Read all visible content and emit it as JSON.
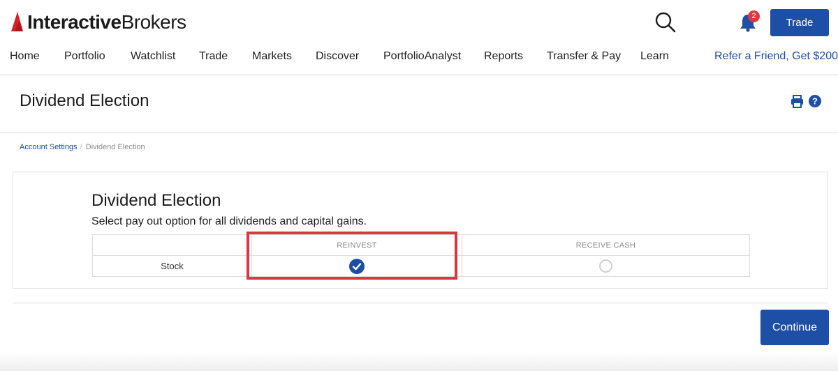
{
  "brand": {
    "name_bold": "Interactive",
    "name_regular": "Brokers",
    "accent": "#d81f26"
  },
  "colors": {
    "primary": "#1d4fa6",
    "alert": "#e2343f"
  },
  "header": {
    "notification_count": "2",
    "trade_label": "Trade",
    "icons": [
      "search-icon",
      "bell-icon"
    ]
  },
  "nav": {
    "items": [
      "Home",
      "Portfolio",
      "Watchlist",
      "Trade",
      "Markets",
      "Discover",
      "PortfolioAnalyst",
      "Reports",
      "Transfer & Pay",
      "Learn"
    ],
    "refer": "Refer a Friend, Get $200"
  },
  "page": {
    "title": "Dividend Election",
    "icons": [
      "print-icon",
      "help-icon"
    ]
  },
  "breadcrumb": {
    "parent": "Account Settings",
    "separator": "/",
    "current": "Dividend Election"
  },
  "election": {
    "title": "Dividend Election",
    "subtitle": "Select pay out option for all dividends and capital gains.",
    "columns": [
      "",
      "REINVEST",
      "RECEIVE CASH"
    ],
    "rows": [
      {
        "label": "Stock",
        "reinvest_selected": true,
        "receive_cash_selected": false
      }
    ]
  },
  "actions": {
    "continue_label": "Continue"
  }
}
